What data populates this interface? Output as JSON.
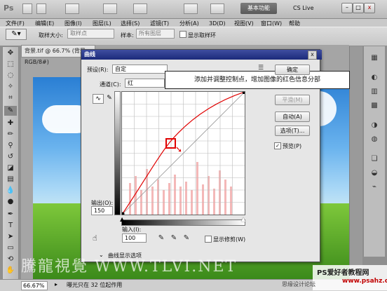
{
  "app": {
    "logo": "Ps",
    "menus": [
      "文件(F)",
      "编辑(E)",
      "图像(I)",
      "图层(L)",
      "选择(S)",
      "滤镜(T)",
      "分析(A)",
      "3D(D)",
      "视图(V)",
      "窗口(W)",
      "帮助"
    ],
    "workspace_label": "基本功能",
    "cslive_label": "CS Live",
    "window_controls": [
      "–",
      "□",
      "x"
    ]
  },
  "options_bar": {
    "sample_size_label": "取样大小:",
    "sample_size_value": "取样点",
    "sample_label": "样本:",
    "sample_value": "所有图层",
    "show_ring_label": "显示取样环"
  },
  "document": {
    "tab_title": "背景.tif @ 66.7% (背景, RGB/8#)",
    "zoom": "66.67%",
    "status_text": "曝光只在 32 位起作用"
  },
  "dialog": {
    "title": "曲线",
    "close_glyph": "x",
    "preset_label": "预设(R):",
    "preset_value": "自定",
    "channel_label": "通道(C):",
    "channel_value": "红",
    "buttons": {
      "ok": "确定",
      "smooth": "平滑(M)",
      "auto": "自动(A)",
      "options": "选项(T)..."
    },
    "preview_label": "预览(P)",
    "preview_checked": true,
    "output_label": "输出(O):",
    "output_value": "150",
    "input_label": "输入(I):",
    "input_value": "100",
    "show_clipping_label": "显示修剪(W)",
    "curve_display_label": "曲线显示选项",
    "annotation": "添加并调整控制点，增加图像的红色信息分部",
    "curve_color": "#e00000"
  },
  "watermarks": {
    "main": "騰龍視覺 WWW.TLVI.NET",
    "site_title": "PS爱好者教程网",
    "site_url": "www.psahz.com",
    "site_sub": "思缘设计论坛"
  }
}
